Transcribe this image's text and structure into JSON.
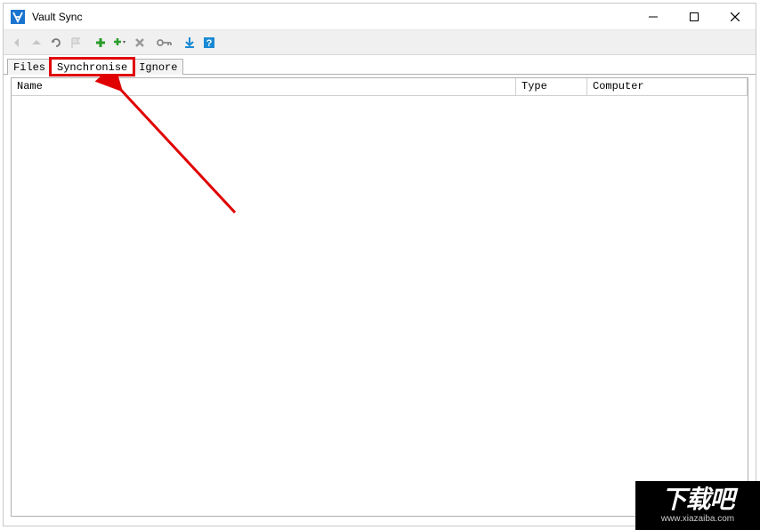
{
  "window": {
    "title": "Vault Sync"
  },
  "tabs": {
    "files": "Files",
    "synchronise": "Synchronise",
    "ignore": "Ignore",
    "active_index": 1
  },
  "columns": {
    "name": "Name",
    "type": "Type",
    "computer": "Computer"
  },
  "toolbar_icons": {
    "back": "back-arrow",
    "up": "up-arrow",
    "refresh": "refresh",
    "flag": "flag",
    "add": "plus",
    "add_dropdown": "plus-dropdown",
    "delete": "delete-x",
    "key": "key",
    "download": "download",
    "help": "help"
  },
  "watermark": {
    "text_big": "下载吧",
    "text_small": "www.xiazaiba.com"
  }
}
